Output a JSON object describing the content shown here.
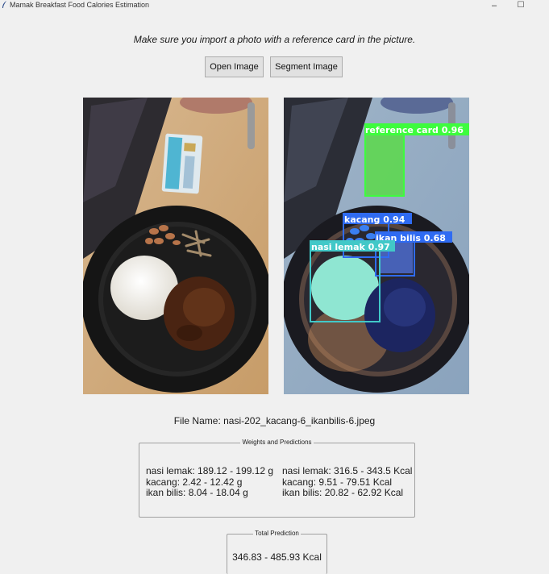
{
  "window": {
    "title": "Mamak Breakfast Food Calories Estimation",
    "minimize_icon": "–",
    "maximize_icon": "☐"
  },
  "instruction": "Make sure you import a photo with a reference card in the picture.",
  "buttons": {
    "open_image": "Open Image",
    "segment_image": "Segment Image"
  },
  "detections": [
    {
      "label": "reference card 0.96",
      "color": "#3dfc3d"
    },
    {
      "label": "kacang 0.94",
      "color": "#2f6bf2"
    },
    {
      "label": "ikan bilis 0.68",
      "color": "#2f6bf2"
    },
    {
      "label": "nasi lemak 0.97",
      "color": "#41c8c8"
    }
  ],
  "file_name": "File Name: nasi-202_kacang-6_ikanbilis-6.jpeg",
  "weights_box": {
    "title": "Weights and Predictions",
    "weights": [
      "nasi lemak: 189.12 - 199.12 g",
      "kacang: 2.42 - 12.42 g",
      "ikan bilis: 8.04 - 18.04 g"
    ],
    "calories": [
      "nasi lemak: 316.5 - 343.5 Kcal",
      "kacang: 9.51 - 79.51 Kcal",
      "ikan bilis: 20.82 - 62.92 Kcal"
    ]
  },
  "total_box": {
    "title": "Total Prediction",
    "value": "346.83 - 485.93 Kcal"
  }
}
